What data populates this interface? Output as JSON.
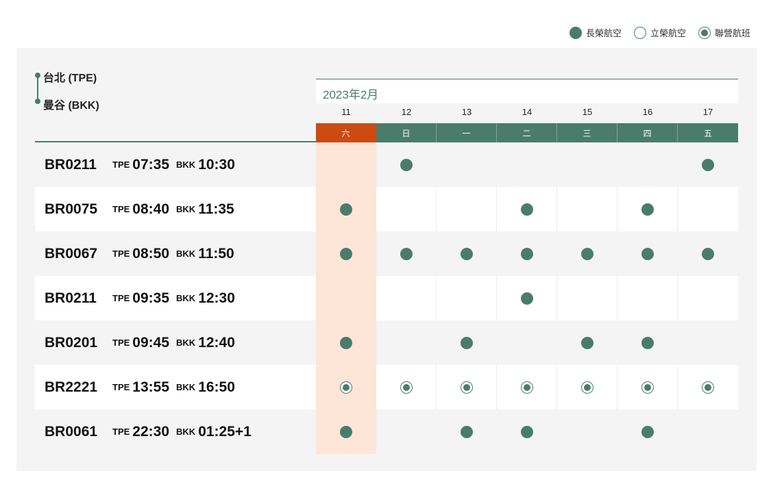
{
  "legend": [
    {
      "label": "長榮航空",
      "type": "solid"
    },
    {
      "label": "立榮航空",
      "type": "empty"
    },
    {
      "label": "聯營航班",
      "type": "ring"
    }
  ],
  "route": {
    "origin": "台北 (TPE)",
    "destination": "曼谷 (BKK)"
  },
  "month": "2023年2月",
  "dates": [
    "11",
    "12",
    "13",
    "14",
    "15",
    "16",
    "17"
  ],
  "weekdays": [
    "六",
    "日",
    "一",
    "二",
    "三",
    "四",
    "五"
  ],
  "selected_index": 0,
  "colors": {
    "accent": "#4a7c6b",
    "selected": "#cc4b12",
    "selected_bg": "#fde5d8"
  },
  "flights": [
    {
      "no": "BR0211",
      "dep_ap": "TPE",
      "dep": "07:35",
      "arr_ap": "BKK",
      "arr": "10:30",
      "days": [
        "",
        "solid",
        "",
        "",
        "",
        "",
        "solid"
      ]
    },
    {
      "no": "BR0075",
      "dep_ap": "TPE",
      "dep": "08:40",
      "arr_ap": "BKK",
      "arr": "11:35",
      "days": [
        "solid",
        "",
        "",
        "solid",
        "",
        "solid",
        ""
      ]
    },
    {
      "no": "BR0067",
      "dep_ap": "TPE",
      "dep": "08:50",
      "arr_ap": "BKK",
      "arr": "11:50",
      "days": [
        "solid",
        "solid",
        "solid",
        "solid",
        "solid",
        "solid",
        "solid"
      ]
    },
    {
      "no": "BR0211",
      "dep_ap": "TPE",
      "dep": "09:35",
      "arr_ap": "BKK",
      "arr": "12:30",
      "days": [
        "",
        "",
        "",
        "solid",
        "",
        "",
        ""
      ]
    },
    {
      "no": "BR0201",
      "dep_ap": "TPE",
      "dep": "09:45",
      "arr_ap": "BKK",
      "arr": "12:40",
      "days": [
        "solid",
        "",
        "solid",
        "",
        "solid",
        "solid",
        ""
      ]
    },
    {
      "no": "BR2221",
      "dep_ap": "TPE",
      "dep": "13:55",
      "arr_ap": "BKK",
      "arr": "16:50",
      "days": [
        "ring",
        "ring",
        "ring",
        "ring",
        "ring",
        "ring",
        "ring"
      ]
    },
    {
      "no": "BR0061",
      "dep_ap": "TPE",
      "dep": "22:30",
      "arr_ap": "BKK",
      "arr": "01:25+1",
      "days": [
        "solid",
        "",
        "solid",
        "solid",
        "",
        "solid",
        ""
      ]
    }
  ]
}
